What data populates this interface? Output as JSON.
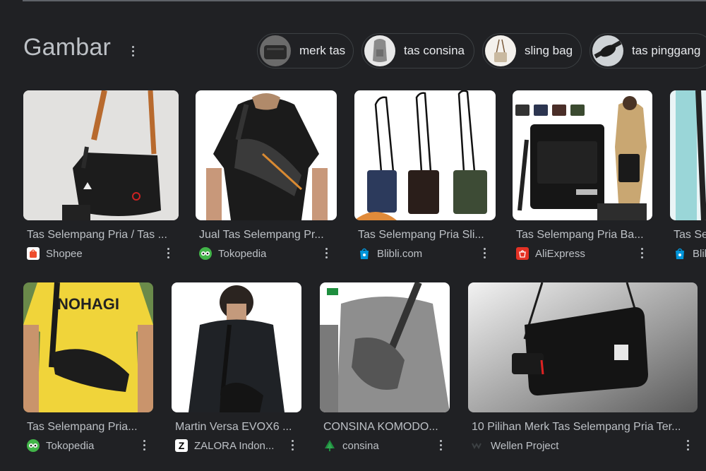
{
  "section": {
    "title": "Gambar"
  },
  "chips": [
    {
      "label": "merk tas",
      "thumb": "black-bag-thumb"
    },
    {
      "label": "tas consina",
      "thumb": "grey-backpack-thumb"
    },
    {
      "label": "sling bag",
      "thumb": "small-sling-thumb"
    },
    {
      "label": "tas pinggang",
      "thumb": "waist-bag-thumb"
    }
  ],
  "row1": [
    {
      "title": "Tas Selempang Pria / Tas ...",
      "source": "Shopee",
      "favicon": "shopee-icon",
      "color": "#ee4d2d"
    },
    {
      "title": "Jual Tas Selempang Pr...",
      "source": "Tokopedia",
      "favicon": "tokopedia-icon",
      "color": "#42b549"
    },
    {
      "title": "Tas Selempang Pria Sli...",
      "source": "Blibli.com",
      "favicon": "blibli-icon",
      "color": "#0095da"
    },
    {
      "title": "Tas Selempang Pria Ba...",
      "source": "AliExpress",
      "favicon": "aliexpress-icon",
      "color": "#e43225"
    },
    {
      "title": "Tas Se",
      "source": "Blib",
      "favicon": "blibli-icon",
      "color": "#0095da"
    }
  ],
  "row2": [
    {
      "title": "Tas Selempang Pria...",
      "source": "Tokopedia",
      "favicon": "tokopedia-icon",
      "color": "#42b549",
      "shirt_text": "NOHAGI"
    },
    {
      "title": "Martin Versa EVOX6 ...",
      "source": "ZALORA Indon...",
      "favicon": "zalora-icon",
      "color": "#000000",
      "fav_letter": "Z"
    },
    {
      "title": "CONSINA KOMODO...",
      "source": "consina",
      "favicon": "consina-icon",
      "color": "#1e8e3e"
    },
    {
      "title": "10 Pilihan Merk Tas Selempang Pria Ter...",
      "source": "Wellen Project",
      "favicon": "wellen-icon",
      "color": "#3c4043"
    }
  ]
}
